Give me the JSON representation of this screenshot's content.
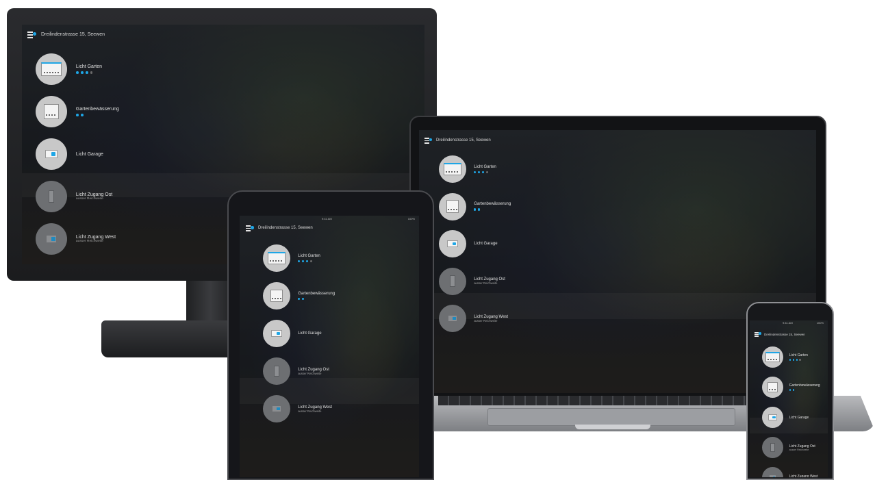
{
  "app": {
    "title": "Dreilindenstrasse 15, Seewen",
    "accent_color": "#1ea6e6",
    "menu_icon": "menu-with-status-dot-icon",
    "devices": [
      {
        "name": "Licht Garten",
        "subtitle": "",
        "icon": "light-panel-icon",
        "dots_on": 3,
        "dots_total": 4,
        "active": true
      },
      {
        "name": "Gartenbewässerung",
        "subtitle": "",
        "icon": "irrigation-panel-icon",
        "dots_on": 2,
        "dots_total": 2,
        "active": true
      },
      {
        "name": "Licht Garage",
        "subtitle": "",
        "icon": "switch-icon",
        "dots_on": 0,
        "dots_total": 0,
        "active": true
      },
      {
        "name": "Licht Zugang Ost",
        "subtitle": "ausser Reichweite",
        "icon": "wall-switch-icon",
        "dots_on": 0,
        "dots_total": 0,
        "active": false
      },
      {
        "name": "Licht Zugang West",
        "subtitle": "ausser Reichweite",
        "icon": "mini-switch-icon",
        "dots_on": 0,
        "dots_total": 0,
        "active": false
      }
    ]
  },
  "tablet_status": {
    "carrier": "",
    "time": "9:41 AM",
    "battery": "100%"
  },
  "phone_status": {
    "time": "9:41 AM",
    "battery": "100%"
  }
}
